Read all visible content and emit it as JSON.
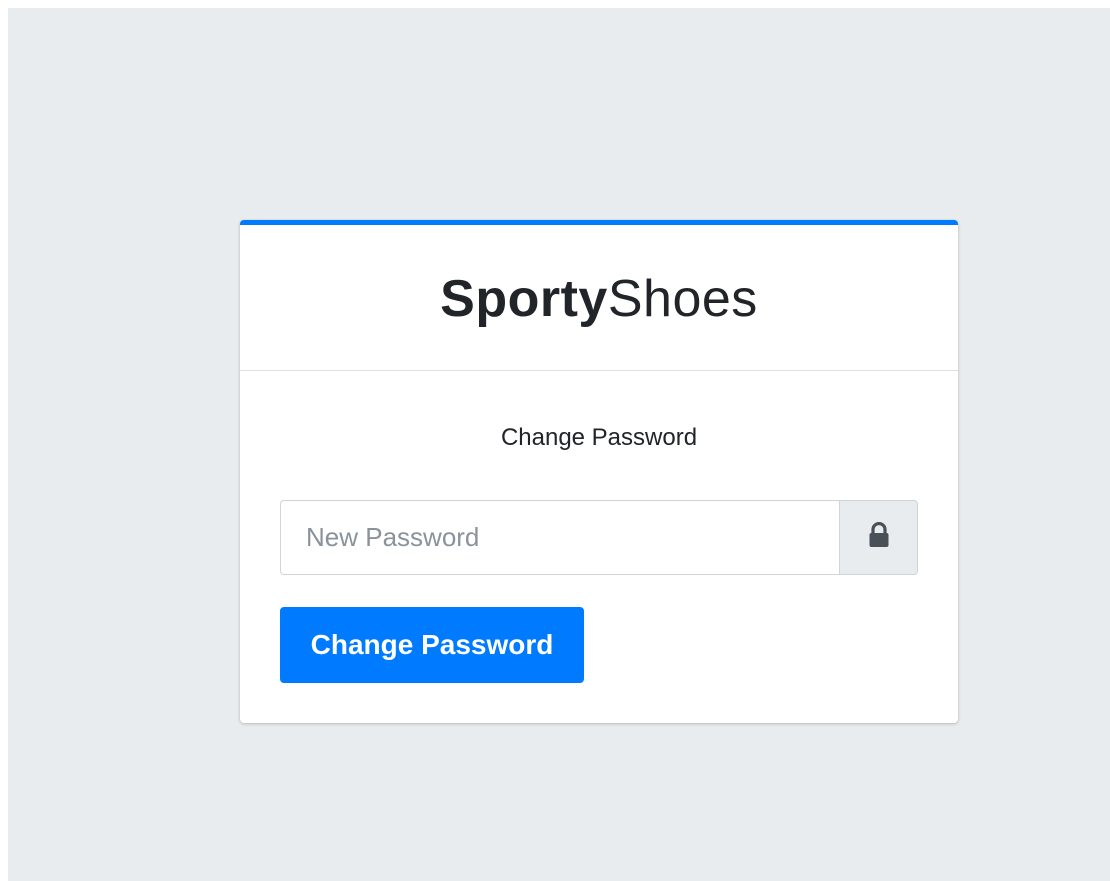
{
  "brand": {
    "bold": "Sporty",
    "light": "Shoes"
  },
  "form": {
    "message": "Change Password",
    "password_placeholder": "New Password",
    "password_value": "",
    "input_icon": "lock-icon",
    "submit_label": "Change Password"
  },
  "colors": {
    "accent": "#007bff",
    "page_background": "#e9ecef",
    "card_background": "#ffffff"
  }
}
